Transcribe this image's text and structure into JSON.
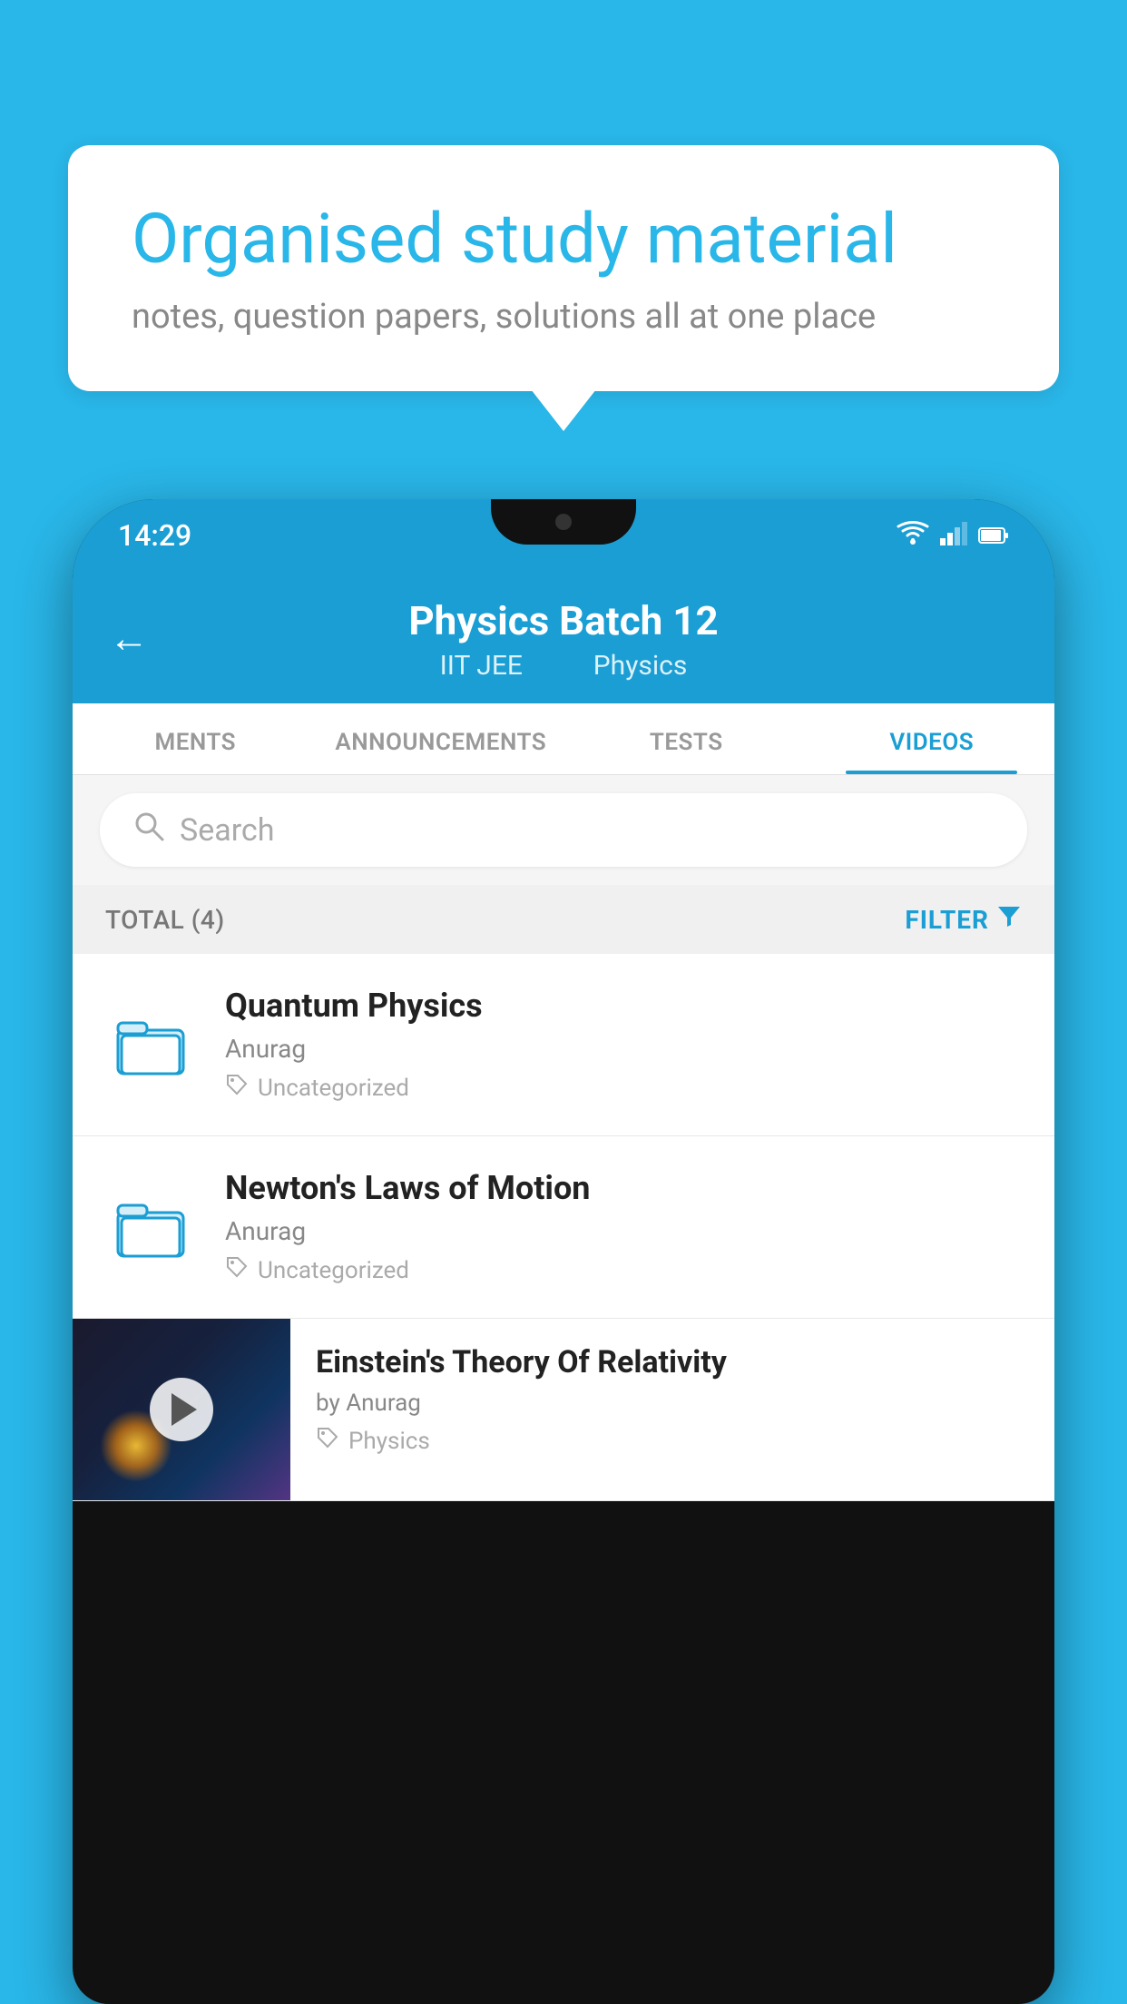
{
  "background_color": "#29b6e8",
  "bubble": {
    "title": "Organised study material",
    "subtitle": "notes, question papers, solutions all at one place"
  },
  "status_bar": {
    "time": "14:29",
    "icons": [
      "wifi",
      "signal",
      "battery"
    ]
  },
  "header": {
    "title": "Physics Batch 12",
    "subtitle_part1": "IIT JEE",
    "subtitle_part2": "Physics"
  },
  "tabs": [
    {
      "label": "MENTS",
      "active": false
    },
    {
      "label": "ANNOUNCEMENTS",
      "active": false
    },
    {
      "label": "TESTS",
      "active": false
    },
    {
      "label": "VIDEOS",
      "active": true
    }
  ],
  "search": {
    "placeholder": "Search"
  },
  "filter_bar": {
    "total_label": "TOTAL (4)",
    "filter_label": "FILTER"
  },
  "videos": [
    {
      "id": 1,
      "type": "folder",
      "title": "Quantum Physics",
      "author": "Anurag",
      "tag": "Uncategorized",
      "has_thumb": false
    },
    {
      "id": 2,
      "type": "folder",
      "title": "Newton's Laws of Motion",
      "author": "Anurag",
      "tag": "Uncategorized",
      "has_thumb": false
    },
    {
      "id": 3,
      "type": "video",
      "title": "Einstein's Theory Of Relativity",
      "author": "by Anurag",
      "tag": "Physics",
      "has_thumb": true
    }
  ]
}
